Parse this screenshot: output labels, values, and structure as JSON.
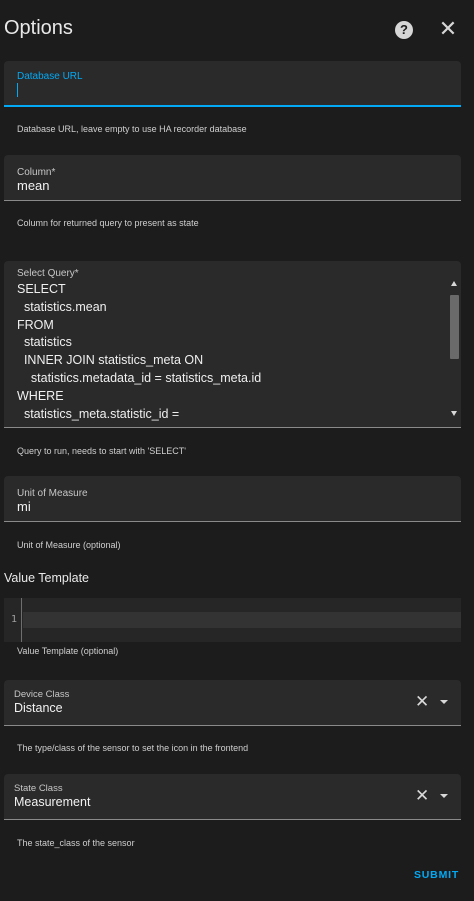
{
  "dialog": {
    "title": "Options",
    "help_glyph": "?",
    "close_glyph": "✕"
  },
  "fields": {
    "database_url": {
      "label": "Database URL",
      "value": "",
      "helper": "Database URL, leave empty to use HA recorder database"
    },
    "column": {
      "label": "Column*",
      "value": "mean",
      "helper": "Column for returned query to present as state"
    },
    "select_query": {
      "label": "Select Query*",
      "value": "SELECT\n  statistics.mean\nFROM\n  statistics\n  INNER JOIN statistics_meta ON\n    statistics.metadata_id = statistics_meta.id\nWHERE\n  statistics_meta.statistic_id =",
      "helper": "Query to run, needs to start with 'SELECT'"
    },
    "unit_of_measure": {
      "label": "Unit of Measure",
      "value": "mi",
      "helper": "Unit of Measure (optional)"
    },
    "value_template": {
      "section_title": "Value Template",
      "line_number": "1",
      "value": "",
      "helper": "Value Template (optional)"
    },
    "device_class": {
      "label": "Device Class",
      "value": "Distance",
      "helper": "The type/class of the sensor to set the icon in the frontend"
    },
    "state_class": {
      "label": "State Class",
      "value": "Measurement",
      "helper": "The state_class of the sensor"
    }
  },
  "icons": {
    "clear_glyph": "✕"
  },
  "actions": {
    "submit_label": "SUBMIT"
  },
  "colors": {
    "accent": "#03a9f4",
    "background": "#1c1c1c",
    "field_background": "#2a2a2a"
  }
}
